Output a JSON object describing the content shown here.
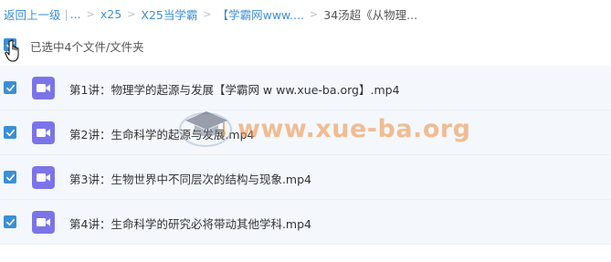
{
  "breadcrumb": {
    "back_label": "返回上一级",
    "pipe": "|",
    "ellipsis": "...",
    "items": [
      "x25",
      "X25当学霸",
      "【学霸网www....",
      "34汤超《从物理..."
    ],
    "separator": ">"
  },
  "selection": {
    "count_text": "已选中4个文件/文件夹"
  },
  "files": [
    {
      "name": "第1讲：物理学的起源与发展【学霸网 w ww.xue-ba.org】.mp4",
      "checked": true,
      "icon": "video-file-icon"
    },
    {
      "name": "第2讲：生命科学的起源与发展.mp4",
      "checked": true,
      "icon": "video-file-icon"
    },
    {
      "name": "第3讲：生物世界中不同层次的结构与现象.mp4",
      "checked": true,
      "icon": "video-file-icon"
    },
    {
      "name": "第4讲：生命科学的研究必将带动其他学科.mp4",
      "checked": true,
      "icon": "video-file-icon"
    }
  ],
  "watermark": {
    "text": "www.xue-ba.org"
  },
  "colors": {
    "accent": "#3b8fd6",
    "video_icon": "#7b74e8",
    "row_bg": "#f4f8fd",
    "watermark": "#ec8a3c"
  }
}
